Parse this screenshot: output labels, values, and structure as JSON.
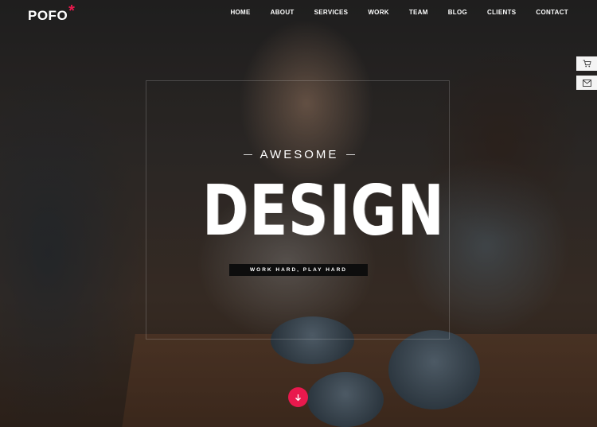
{
  "logo": {
    "text": "POFO",
    "mark": "*"
  },
  "nav": {
    "items": [
      {
        "label": "HOME"
      },
      {
        "label": "ABOUT"
      },
      {
        "label": "SERVICES"
      },
      {
        "label": "WORK"
      },
      {
        "label": "TEAM"
      },
      {
        "label": "BLOG"
      },
      {
        "label": "CLIENTS"
      },
      {
        "label": "CONTACT"
      }
    ]
  },
  "hero": {
    "eyebrow": "AWESOME",
    "headline": "DESIGN",
    "tagline": "WORK HARD, PLAY HARD"
  },
  "side_buttons": [
    {
      "icon": "cart-icon"
    },
    {
      "icon": "mail-icon"
    }
  ],
  "scroll_button": {
    "icon": "arrow-down-icon"
  },
  "colors": {
    "accent": "#e9194d",
    "text": "#ffffff",
    "tag_bg": "#0d0d0d",
    "side_bg": "#f4f4f4"
  }
}
